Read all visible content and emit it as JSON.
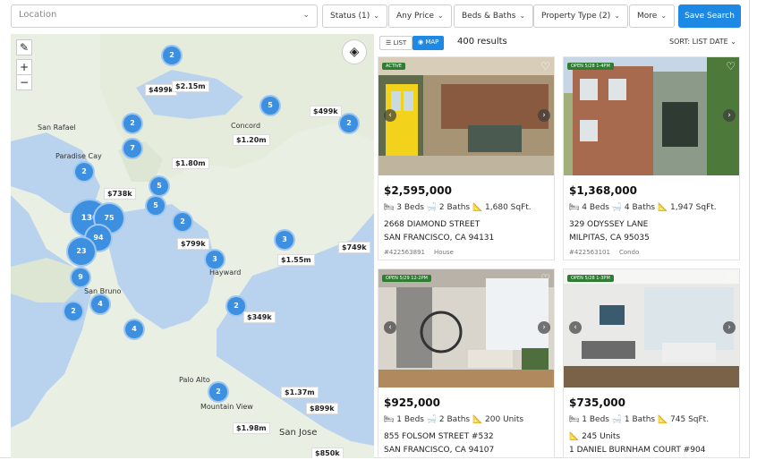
{
  "filters": {
    "location_placeholder": "Location",
    "status": "Status (1)",
    "price": "Any Price",
    "beds_baths": "Beds & Baths",
    "property_type": "Property Type (2)",
    "more": "More",
    "save_search": "Save Search"
  },
  "results": {
    "list_label": "LIST",
    "map_label": "MAP",
    "count": "400 results",
    "sort": "SORT: LIST DATE"
  },
  "map": {
    "places": [
      "San Rafael",
      "Paradise Cay",
      "Concord",
      "Hayward",
      "San Bruno",
      "Palo Alto",
      "Mountain View",
      "San Jose"
    ],
    "clusters": [
      "2",
      "2",
      "5",
      "2",
      "7",
      "2",
      "5",
      "5",
      "2",
      "130",
      "75",
      "94",
      "23",
      "3",
      "9",
      "3",
      "4",
      "2",
      "2",
      "4",
      "2"
    ],
    "prices": [
      "$499k",
      "$2.15m",
      "$499k",
      "$1.20m",
      "$1.80m",
      "$738k",
      "$799k",
      "$1.55m",
      "$749k",
      "$349k",
      "$1.37m",
      "$899k",
      "$1.98m",
      "$850k"
    ]
  },
  "listings": [
    {
      "badge": "ACTIVE",
      "price": "$2,595,000",
      "features": "🛏 3 Beds 🛁 2 Baths 📐 1,680 SqFt.",
      "address1": "2668 DIAMOND STREET",
      "address2": "SAN FRANCISCO, CA 94131",
      "mls": "#422563891",
      "type": "House"
    },
    {
      "badge": "OPEN 5/28 1-4PM",
      "price": "$1,368,000",
      "features": "🛏 4 Beds 🛁 4 Baths 📐 1,947 SqFt.",
      "address1": "329 ODYSSEY LANE",
      "address2": "MILPITAS, CA 95035",
      "mls": "#422563101",
      "type": "Condo"
    },
    {
      "badge": "OPEN 5/29 12-2PM",
      "price": "$925,000",
      "features": "🛏 1 Beds 🛁 2 Baths 📐 200 Units",
      "address1": "855 FOLSOM STREET #532",
      "address2": "SAN FRANCISCO, CA 94107",
      "mls": "",
      "type": ""
    },
    {
      "badge": "OPEN 5/28 1-3PM",
      "price": "$735,000",
      "features": "🛏 1 Beds 🛁 1 Baths 📐 745 SqFt.",
      "address1": "📐 245 Units",
      "address2": "1 DANIEL BURNHAM COURT #904",
      "mls": "",
      "type": ""
    }
  ]
}
